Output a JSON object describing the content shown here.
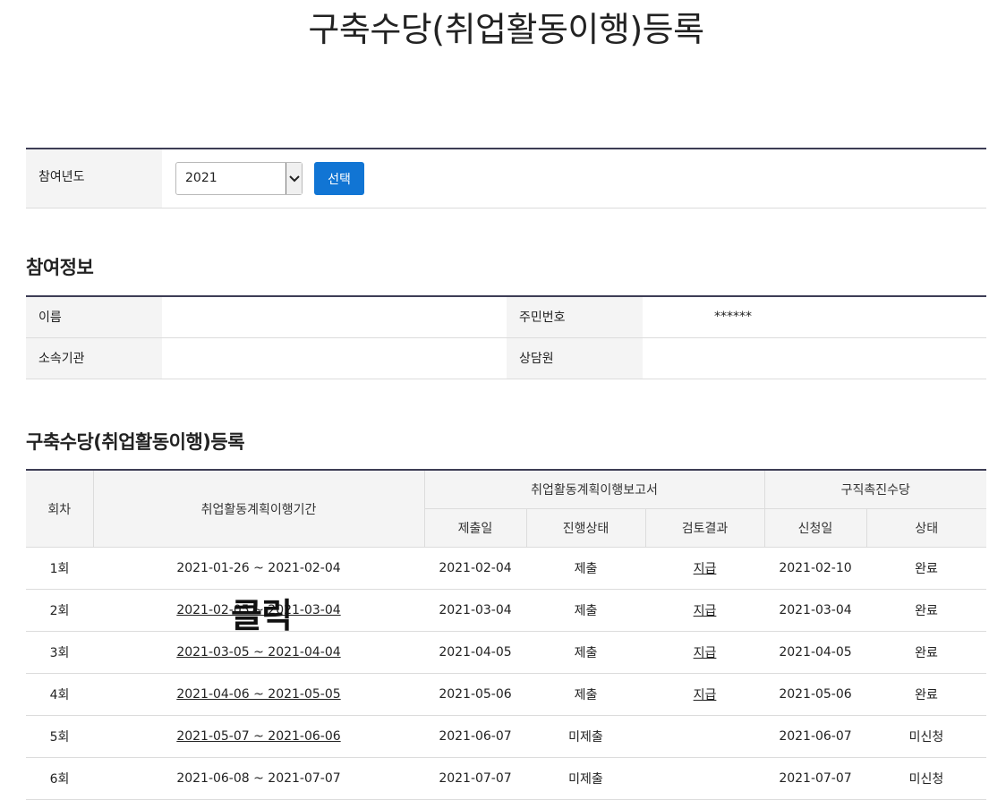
{
  "page_title": "구축수당(취업활동이행)등록",
  "year_selector": {
    "label": "참여년도",
    "selected": "2021",
    "submit_label": "선택"
  },
  "info_section": {
    "title": "참여정보",
    "name_label": "이름",
    "name_value": "",
    "rrn_label": "주민번호",
    "rrn_value": "******",
    "org_label": "소속기관",
    "org_value": "",
    "counselor_label": "상담원",
    "counselor_value": ""
  },
  "registration_section": {
    "title": "구축수당(취업활동이행)등록",
    "headers": {
      "round": "회차",
      "period": "취업활동계획이행기간",
      "report_group": "취업활동계획이행보고서",
      "allowance_group": "구직촉진수당",
      "submit_date": "제출일",
      "progress": "진행상태",
      "review": "검토결과",
      "apply_date": "신청일",
      "status": "상태"
    },
    "rows": [
      {
        "round": "1회",
        "period": "2021-01-26 ~ 2021-02-04",
        "period_link": false,
        "submit_date": "2021-02-04",
        "progress": "제출",
        "review": "지급",
        "apply_date": "2021-02-10",
        "status": "완료"
      },
      {
        "round": "2회",
        "period": "2021-02-05 ~ 2021-03-04",
        "period_link": true,
        "submit_date": "2021-03-04",
        "progress": "제출",
        "review": "지급",
        "apply_date": "2021-03-04",
        "status": "완료"
      },
      {
        "round": "3회",
        "period": "2021-03-05 ~ 2021-04-04",
        "period_link": true,
        "submit_date": "2021-04-05",
        "progress": "제출",
        "review": "지급",
        "apply_date": "2021-04-05",
        "status": "완료"
      },
      {
        "round": "4회",
        "period": "2021-04-06 ~ 2021-05-05",
        "period_link": true,
        "submit_date": "2021-05-06",
        "progress": "제출",
        "review": "지급",
        "apply_date": "2021-05-06",
        "status": "완료"
      },
      {
        "round": "5회",
        "period": "2021-05-07 ~ 2021-06-06",
        "period_link": true,
        "submit_date": "2021-06-07",
        "progress": "미제출",
        "review": "",
        "apply_date": "2021-06-07",
        "status": "미신청"
      },
      {
        "round": "6회",
        "period": "2021-06-08 ~ 2021-07-07",
        "period_link": false,
        "submit_date": "2021-07-07",
        "progress": "미제출",
        "review": "",
        "apply_date": "2021-07-07",
        "status": "미신청"
      }
    ]
  },
  "click_overlay": "클릭"
}
